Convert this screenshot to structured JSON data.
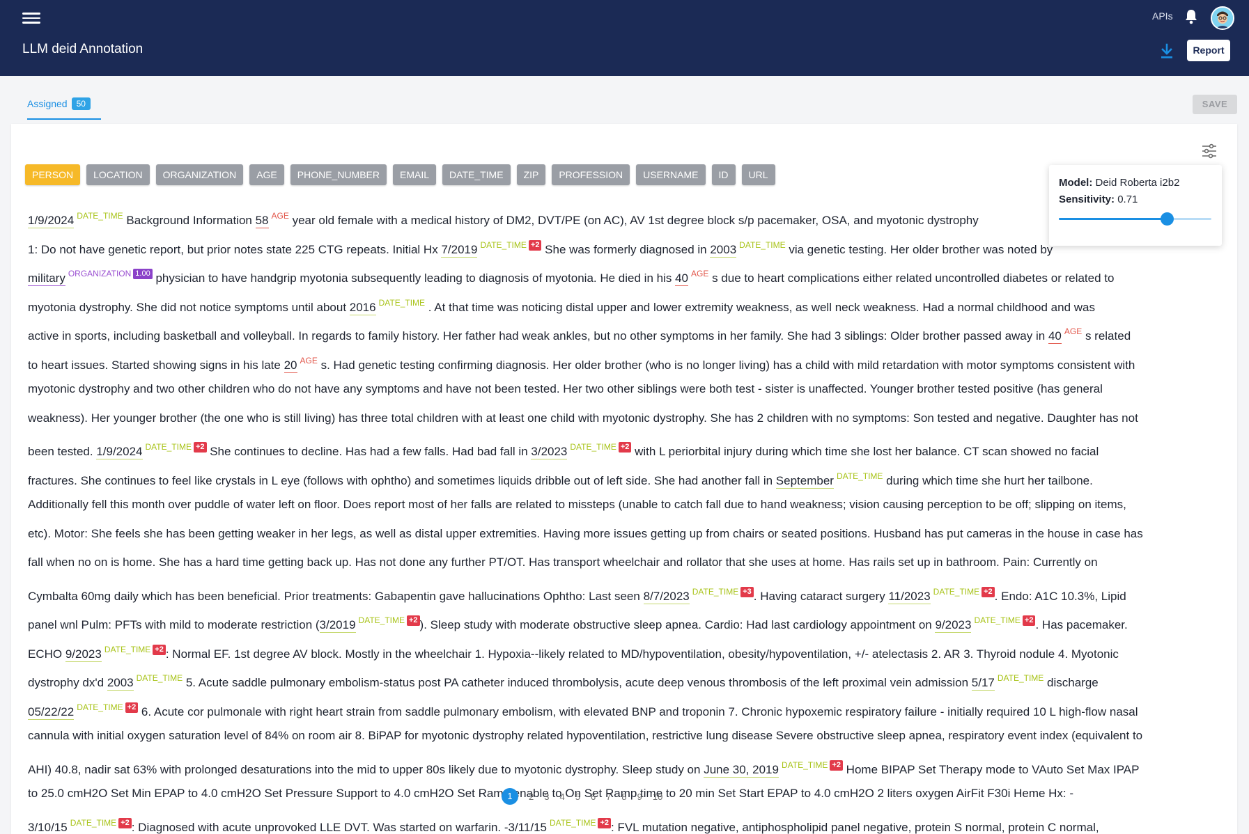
{
  "header": {
    "title": "LLM deid Annotation",
    "apis_label": "APIs",
    "report_label": "Report"
  },
  "tabs": {
    "assigned_label": "Assigned",
    "assigned_count": "50",
    "save_label": "SAVE"
  },
  "labels": [
    "PERSON",
    "LOCATION",
    "ORGANIZATION",
    "AGE",
    "PHONE_NUMBER",
    "EMAIL",
    "DATE_TIME",
    "ZIP",
    "PROFESSION",
    "USERNAME",
    "ID",
    "URL"
  ],
  "active_label": "PERSON",
  "model_popover": {
    "model_label": "Model:",
    "model_value": "Deid Roberta i2b2",
    "sensitivity_label": "Sensitivity:",
    "sensitivity_value": "0.71",
    "sensitivity": 0.71
  },
  "pagination": {
    "pages": [
      "1",
      "2",
      "3",
      "4",
      "5",
      "6",
      "7",
      "8",
      "9",
      "10"
    ],
    "current": "1"
  },
  "colors": {
    "header_bg": "#1b2a55",
    "accent": "#1a8fe3",
    "active_label": "#f6b928",
    "date_tag": "#a8c318",
    "age_tag": "#e2564a",
    "org_tag": "#9a4fd1",
    "plus_badge": "#e23a4a"
  },
  "document": [
    [
      {
        "e": "1/9/2024",
        "t": "DATE_TIME"
      },
      {
        "s": "    Background Information   "
      },
      {
        "e": "58",
        "t": "AGE"
      },
      {
        "s": "  year old female with a medical history of DM2, DVT/PE (on AC), AV 1st degree block s/p pacemaker, OSA, and myotonic dystrophy"
      }
    ],
    [
      {
        "s": "1: Do not have genetic report, but prior notes state 225 CTG repeats.    Initial Hx "
      },
      {
        "e": "7/2019",
        "t": "DATE_TIME",
        "p": "+2"
      },
      {
        "s": "  She was formerly diagnosed in "
      },
      {
        "e": "2003",
        "t": "DATE_TIME"
      },
      {
        "s": "  via genetic testing.  Her older brother was noted by"
      }
    ],
    [
      {
        "e": "military",
        "t": "ORGANIZATION",
        "c": "1.00"
      },
      {
        "s": "  physician to have handgrip myotonia subsequently leading to diagnosis of myotonia.  He died in his "
      },
      {
        "e": "40",
        "t": "AGE"
      },
      {
        "s": "  s due to heart complications either related uncontrolled diabetes or related to"
      }
    ],
    [
      {
        "s": "myotonia dystrophy.    She did not notice symptoms until about "
      },
      {
        "e": "2016",
        "t": "DATE_TIME"
      },
      {
        "s": " .  At that time was noticing distal upper and lower extremity weakness, as well neck weakness.     Had a normal childhood and was"
      }
    ],
    [
      {
        "s": "active in sports, including basketball and volleyball.      In regards to family history.  Her father had weak ankles, but no other symptoms in her family.  She had 3 siblings: Older brother passed away in "
      },
      {
        "e": "40",
        "t": "AGE"
      },
      {
        "s": " s related"
      }
    ],
    [
      {
        "s": "to heart issues.  Started showing signs in his late "
      },
      {
        "e": "20",
        "t": "AGE"
      },
      {
        "s": "  s. Had genetic testing confirming diagnosis. Her older brother (who is no longer living) has a child with mild retardation with motor symptoms consistent with"
      }
    ],
    [
      {
        "s": "myotonic dystrophy and two other children who do not have any symptoms and have not been tested.  Her two other siblings were both test - sister is unaffected. Younger brother tested positive (has general"
      }
    ],
    [
      {
        "s": "weakness).  Her younger brother (the one who is still living) has three total children with at least one child with myotonic dystrophy.  She has 2 children with no symptoms: Son tested and negative.  Daughter has not"
      }
    ],
    [
      {
        "s": "been tested.     "
      },
      {
        "e": "1/9/2024",
        "t": "DATE_TIME",
        "p": "+2"
      },
      {
        "s": "    She continues to decline.  Has had a few falls. Had bad fall in "
      },
      {
        "e": "3/2023",
        "t": "DATE_TIME",
        "p": "+2"
      },
      {
        "s": "  with L periorbital injury during which time she lost her balance.  CT scan showed no facial"
      }
    ],
    [
      {
        "s": "fractures.  She continues to feel like crystals in L eye (follows with ophtho) and sometimes liquids dribble out of left side.  She had another fall in "
      },
      {
        "e": "September",
        "t": "DATE_TIME"
      },
      {
        "s": "  during which time she hurt her tailbone."
      }
    ],
    [
      {
        "s": "Additionally fell this month over puddle of water left on floor. Does report most of her falls are related to missteps (unable to catch fall due to hand weakness; vision causing perception to be off; slipping on items,"
      }
    ],
    [
      {
        "s": "etc).    Motor: She feels she has been getting weaker in her legs, as well as distal upper extremities.  Having more issues getting up from chairs or seated positions.  Husband has put cameras in the house in case has"
      }
    ],
    [
      {
        "s": "fall when no on is home.  She has a hard time getting back up. Has not done any further PT/OT.  Has transport wheelchair and rollator that she uses at home.  Has rails set up in bathroom.     Pain:  Currently on"
      }
    ],
    [
      {
        "s": "Cymbalta 60mg daily which has been beneficial.  Prior treatments: Gabapentin gave hallucinations   Ophtho: Last seen "
      },
      {
        "e": "8/7/2023",
        "t": "DATE_TIME",
        "p": "+3"
      },
      {
        "s": ". Having cataract surgery "
      },
      {
        "e": "11/2023",
        "t": "DATE_TIME",
        "p": "+2"
      },
      {
        "s": ".  Endo: A1C 10.3%, Lipid"
      }
    ],
    [
      {
        "s": "panel wnl  Pulm: PFTs with mild to moderate restriction ("
      },
      {
        "e": "3/2019",
        "t": "DATE_TIME",
        "p": "+2"
      },
      {
        "s": "). Sleep study with moderate obstructive sleep apnea.    Cardio: Had last cardiology appointment on "
      },
      {
        "e": "9/2023",
        "t": "DATE_TIME",
        "p": "+2"
      },
      {
        "s": ". Has pacemaker."
      }
    ],
    [
      {
        "s": "ECHO "
      },
      {
        "e": "9/2023",
        "t": "DATE_TIME",
        "p": "+2"
      },
      {
        "s": ": Normal EF.  1st degree AV block.      Mostly in the wheelchair    1. Hypoxia--likely related to MD/hypoventilation, obesity/hypoventilation, +/- atelectasis  2. AR  3. Thyroid nodule  4. Myotonic"
      }
    ],
    [
      {
        "s": "dystrophy dx'd "
      },
      {
        "e": "2003",
        "t": "DATE_TIME"
      },
      {
        "s": "   5. Acute saddle pulmonary embolism-status post PA catheter induced thrombolysis, acute deep venous thrombosis of the left proximal vein admission "
      },
      {
        "e": "5/17",
        "t": "DATE_TIME"
      },
      {
        "s": "  discharge"
      }
    ],
    [
      {
        "e": "05/22/22",
        "t": "DATE_TIME",
        "p": "+2"
      },
      {
        "s": "  6. Acute cor pulmonale with right heart strain from saddle pulmonary embolism, with elevated BNP and troponin  7. Chronic hypoxemic respiratory failure - initially required 10 L high-flow nasal"
      }
    ],
    [
      {
        "s": "cannula with initial oxygen saturation level of 84% on room air  8. BiPAP for myotonic dystrophy related hypoventilation, restrictive lung disease    Severe obstructive sleep apnea, respiratory event index (equivalent to"
      }
    ],
    [
      {
        "s": "AHI) 40.8, nadir sat 63% with prolonged desaturations into the mid to upper 80s likely due to myotonic dystrophy.  Sleep study on "
      },
      {
        "e": "June 30, 2019",
        "t": "DATE_TIME",
        "p": "+2"
      },
      {
        "s": "   Home BIPAP    Set Therapy mode to VAuto  Set Max IPAP"
      }
    ],
    [
      {
        "s": "to 25.0 cmH2O  Set Min EPAP to 4.0 cmH2O  Set Pressure Support to 4.0 cmH2O  Set Ramp enable to On  Set Ramp time to 20 min  Set Start EPAP to 4.0 cmH2O  2 liters oxygen  AirFit F30i    Heme Hx:  -"
      }
    ],
    [
      {
        "e": "3/10/15",
        "t": "DATE_TIME",
        "p": "+2"
      },
      {
        "s": ": Diagnosed with acute unprovoked LLE DVT. Was started on warfarin.  -"
      },
      {
        "e": "3/11/15",
        "t": "DATE_TIME",
        "p": "+2"
      },
      {
        "s": ": FVL mutation negative, antiphospholipid panel negative, protein S normal, protein C normal,"
      }
    ]
  ]
}
